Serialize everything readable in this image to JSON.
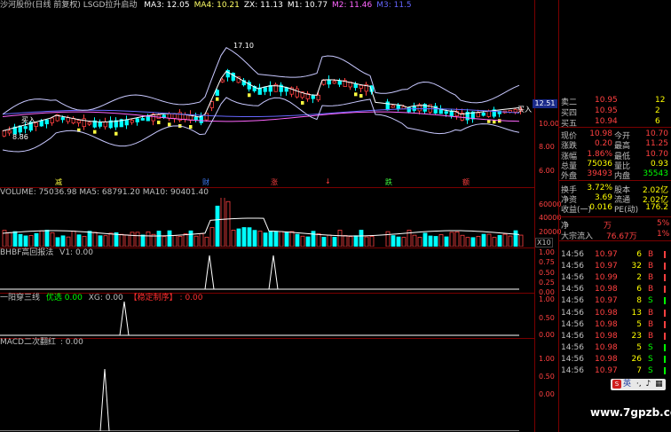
{
  "main_chart": {
    "title": "沙河股份(日线 前复权) LSGD拉升启动",
    "ma": [
      {
        "label": "MA3: 12.05",
        "color": "#ffffff"
      },
      {
        "label": "MA4: 10.21",
        "color": "#ffff66"
      },
      {
        "label": "ZX: 11.13",
        "color": "#ffffff"
      },
      {
        "label": "M1: 10.77",
        "color": "#ffffff"
      },
      {
        "label": "M2: 11.46",
        "color": "#ff66ff"
      },
      {
        "label": "M3: 11.5",
        "color": "#6666ff"
      }
    ],
    "annotations": {
      "high": "17.10",
      "low": "8.86",
      "buy_left": "买入",
      "buy_right": "买入"
    },
    "markers": [
      "减",
      "财",
      "涨",
      "↓",
      "跌",
      "额"
    ],
    "yaxis": [
      "12.51",
      "10.00",
      "8.00",
      "6.00"
    ],
    "ylim": [
      4.6,
      19.5
    ]
  },
  "volume": {
    "title": "VOLUME: 75036.98 MA5: 68791.20 MA10: 90401.40",
    "yaxis": [
      "60000",
      "40000",
      "20000"
    ],
    "unit": "X10"
  },
  "panel2": {
    "name": "BHBF高回报法",
    "value": "V1: 0.00",
    "yaxis": [
      "1.00",
      "0.75",
      "0.50",
      "0.25",
      "0.00"
    ]
  },
  "panel3": {
    "name": "一阳穿三线",
    "flag1": "优选",
    "val1": "0.00",
    "flag2": "XG: 0.00",
    "flag3": "【稳定制序】",
    "val3": ": 0.00",
    "yaxis": [
      "1.00",
      "0.50",
      "0.00"
    ]
  },
  "panel4": {
    "name": "MACD二次翻红",
    "value": ": 0.00",
    "yaxis": [
      "1.00",
      "0.50",
      "0.00"
    ]
  },
  "quote": {
    "asks": [
      {
        "label": "卖二",
        "price": "10.95",
        "vol": "12"
      },
      {
        "label": "买四",
        "price": "10.95",
        "vol": "2"
      },
      {
        "label": "买五",
        "price": "10.94",
        "vol": "6"
      }
    ],
    "rows": [
      {
        "l1": "现价",
        "v1": "10.98",
        "l2": "今开",
        "v2": "10.70",
        "c1": "#ff4040",
        "c2": "#ff4040"
      },
      {
        "l1": "涨跌",
        "v1": "0.20",
        "l2": "最高",
        "v2": "11.25",
        "c1": "#ff4040",
        "c2": "#ff4040"
      },
      {
        "l1": "涨幅",
        "v1": "1.86%",
        "l2": "最低",
        "v2": "10.70",
        "c1": "#ff4040",
        "c2": "#ff4040"
      },
      {
        "l1": "总量",
        "v1": "75036",
        "l2": "量比",
        "v2": "0.93",
        "c1": "#ffff00",
        "c2": "#ffff00"
      },
      {
        "l1": "外盘",
        "v1": "39493",
        "l2": "内盘",
        "v2": "35543",
        "c1": "#ff4040",
        "c2": "#00ff00"
      },
      {
        "l1": "换手",
        "v1": "3.72%",
        "l2": "股本",
        "v2": "2.02亿",
        "c1": "#ffff00",
        "c2": "#ffff00"
      },
      {
        "l1": "净资",
        "v1": "3.69",
        "l2": "流通",
        "v2": "2.02亿",
        "c1": "#ffff00",
        "c2": "#ffff00"
      },
      {
        "l1": "收益(一)",
        "v1": "0.016",
        "l2": "PE(动)",
        "v2": "176.2",
        "c1": "#ffff00",
        "c2": "#ffff00"
      }
    ],
    "net": {
      "label": "净",
      "value": "万",
      "pct": "5%"
    },
    "big_in": {
      "label": "大宗流入",
      "value": "76.67万",
      "pct": "1%"
    }
  },
  "ticks": [
    {
      "time": "14:56",
      "price": "10.97",
      "vol": "6",
      "side": "B"
    },
    {
      "time": "14:56",
      "price": "10.97",
      "vol": "32",
      "side": "B"
    },
    {
      "time": "14:56",
      "price": "10.99",
      "vol": "2",
      "side": "B"
    },
    {
      "time": "14:56",
      "price": "10.98",
      "vol": "6",
      "side": "B"
    },
    {
      "time": "14:56",
      "price": "10.97",
      "vol": "8",
      "side": "S"
    },
    {
      "time": "14:56",
      "price": "10.98",
      "vol": "13",
      "side": "B"
    },
    {
      "time": "14:56",
      "price": "10.98",
      "vol": "5",
      "side": "B"
    },
    {
      "time": "14:56",
      "price": "10.98",
      "vol": "23",
      "side": "B"
    },
    {
      "time": "14:56",
      "price": "10.98",
      "vol": "5",
      "side": "S"
    },
    {
      "time": "14:56",
      "price": "10.98",
      "vol": "26",
      "side": "S"
    },
    {
      "time": "14:56",
      "price": "10.97",
      "vol": "7",
      "side": "S"
    }
  ],
  "colors": {
    "up": "#ff4040",
    "down": "#00ffff",
    "grid": "#7a0000",
    "text": "#c0c0c0"
  },
  "watermark": "www.7gpzb.com",
  "ime": {
    "label": "英"
  }
}
